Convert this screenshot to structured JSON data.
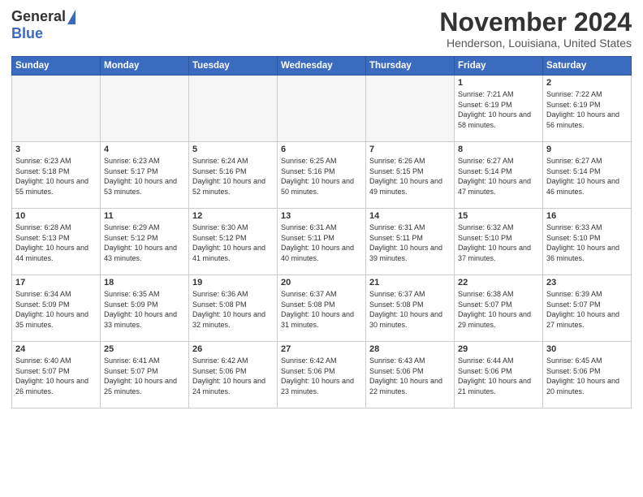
{
  "header": {
    "logo_general": "General",
    "logo_blue": "Blue",
    "month_title": "November 2024",
    "location": "Henderson, Louisiana, United States"
  },
  "days_of_week": [
    "Sunday",
    "Monday",
    "Tuesday",
    "Wednesday",
    "Thursday",
    "Friday",
    "Saturday"
  ],
  "weeks": [
    [
      {
        "day": "",
        "empty": true
      },
      {
        "day": "",
        "empty": true
      },
      {
        "day": "",
        "empty": true
      },
      {
        "day": "",
        "empty": true
      },
      {
        "day": "",
        "empty": true
      },
      {
        "day": "1",
        "sunrise": "Sunrise: 7:21 AM",
        "sunset": "Sunset: 6:19 PM",
        "daylight": "Daylight: 10 hours and 58 minutes."
      },
      {
        "day": "2",
        "sunrise": "Sunrise: 7:22 AM",
        "sunset": "Sunset: 6:19 PM",
        "daylight": "Daylight: 10 hours and 56 minutes."
      }
    ],
    [
      {
        "day": "3",
        "sunrise": "Sunrise: 6:23 AM",
        "sunset": "Sunset: 5:18 PM",
        "daylight": "Daylight: 10 hours and 55 minutes."
      },
      {
        "day": "4",
        "sunrise": "Sunrise: 6:23 AM",
        "sunset": "Sunset: 5:17 PM",
        "daylight": "Daylight: 10 hours and 53 minutes."
      },
      {
        "day": "5",
        "sunrise": "Sunrise: 6:24 AM",
        "sunset": "Sunset: 5:16 PM",
        "daylight": "Daylight: 10 hours and 52 minutes."
      },
      {
        "day": "6",
        "sunrise": "Sunrise: 6:25 AM",
        "sunset": "Sunset: 5:16 PM",
        "daylight": "Daylight: 10 hours and 50 minutes."
      },
      {
        "day": "7",
        "sunrise": "Sunrise: 6:26 AM",
        "sunset": "Sunset: 5:15 PM",
        "daylight": "Daylight: 10 hours and 49 minutes."
      },
      {
        "day": "8",
        "sunrise": "Sunrise: 6:27 AM",
        "sunset": "Sunset: 5:14 PM",
        "daylight": "Daylight: 10 hours and 47 minutes."
      },
      {
        "day": "9",
        "sunrise": "Sunrise: 6:27 AM",
        "sunset": "Sunset: 5:14 PM",
        "daylight": "Daylight: 10 hours and 46 minutes."
      }
    ],
    [
      {
        "day": "10",
        "sunrise": "Sunrise: 6:28 AM",
        "sunset": "Sunset: 5:13 PM",
        "daylight": "Daylight: 10 hours and 44 minutes."
      },
      {
        "day": "11",
        "sunrise": "Sunrise: 6:29 AM",
        "sunset": "Sunset: 5:12 PM",
        "daylight": "Daylight: 10 hours and 43 minutes."
      },
      {
        "day": "12",
        "sunrise": "Sunrise: 6:30 AM",
        "sunset": "Sunset: 5:12 PM",
        "daylight": "Daylight: 10 hours and 41 minutes."
      },
      {
        "day": "13",
        "sunrise": "Sunrise: 6:31 AM",
        "sunset": "Sunset: 5:11 PM",
        "daylight": "Daylight: 10 hours and 40 minutes."
      },
      {
        "day": "14",
        "sunrise": "Sunrise: 6:31 AM",
        "sunset": "Sunset: 5:11 PM",
        "daylight": "Daylight: 10 hours and 39 minutes."
      },
      {
        "day": "15",
        "sunrise": "Sunrise: 6:32 AM",
        "sunset": "Sunset: 5:10 PM",
        "daylight": "Daylight: 10 hours and 37 minutes."
      },
      {
        "day": "16",
        "sunrise": "Sunrise: 6:33 AM",
        "sunset": "Sunset: 5:10 PM",
        "daylight": "Daylight: 10 hours and 36 minutes."
      }
    ],
    [
      {
        "day": "17",
        "sunrise": "Sunrise: 6:34 AM",
        "sunset": "Sunset: 5:09 PM",
        "daylight": "Daylight: 10 hours and 35 minutes."
      },
      {
        "day": "18",
        "sunrise": "Sunrise: 6:35 AM",
        "sunset": "Sunset: 5:09 PM",
        "daylight": "Daylight: 10 hours and 33 minutes."
      },
      {
        "day": "19",
        "sunrise": "Sunrise: 6:36 AM",
        "sunset": "Sunset: 5:08 PM",
        "daylight": "Daylight: 10 hours and 32 minutes."
      },
      {
        "day": "20",
        "sunrise": "Sunrise: 6:37 AM",
        "sunset": "Sunset: 5:08 PM",
        "daylight": "Daylight: 10 hours and 31 minutes."
      },
      {
        "day": "21",
        "sunrise": "Sunrise: 6:37 AM",
        "sunset": "Sunset: 5:08 PM",
        "daylight": "Daylight: 10 hours and 30 minutes."
      },
      {
        "day": "22",
        "sunrise": "Sunrise: 6:38 AM",
        "sunset": "Sunset: 5:07 PM",
        "daylight": "Daylight: 10 hours and 29 minutes."
      },
      {
        "day": "23",
        "sunrise": "Sunrise: 6:39 AM",
        "sunset": "Sunset: 5:07 PM",
        "daylight": "Daylight: 10 hours and 27 minutes."
      }
    ],
    [
      {
        "day": "24",
        "sunrise": "Sunrise: 6:40 AM",
        "sunset": "Sunset: 5:07 PM",
        "daylight": "Daylight: 10 hours and 26 minutes."
      },
      {
        "day": "25",
        "sunrise": "Sunrise: 6:41 AM",
        "sunset": "Sunset: 5:07 PM",
        "daylight": "Daylight: 10 hours and 25 minutes."
      },
      {
        "day": "26",
        "sunrise": "Sunrise: 6:42 AM",
        "sunset": "Sunset: 5:06 PM",
        "daylight": "Daylight: 10 hours and 24 minutes."
      },
      {
        "day": "27",
        "sunrise": "Sunrise: 6:42 AM",
        "sunset": "Sunset: 5:06 PM",
        "daylight": "Daylight: 10 hours and 23 minutes."
      },
      {
        "day": "28",
        "sunrise": "Sunrise: 6:43 AM",
        "sunset": "Sunset: 5:06 PM",
        "daylight": "Daylight: 10 hours and 22 minutes."
      },
      {
        "day": "29",
        "sunrise": "Sunrise: 6:44 AM",
        "sunset": "Sunset: 5:06 PM",
        "daylight": "Daylight: 10 hours and 21 minutes."
      },
      {
        "day": "30",
        "sunrise": "Sunrise: 6:45 AM",
        "sunset": "Sunset: 5:06 PM",
        "daylight": "Daylight: 10 hours and 20 minutes."
      }
    ]
  ]
}
